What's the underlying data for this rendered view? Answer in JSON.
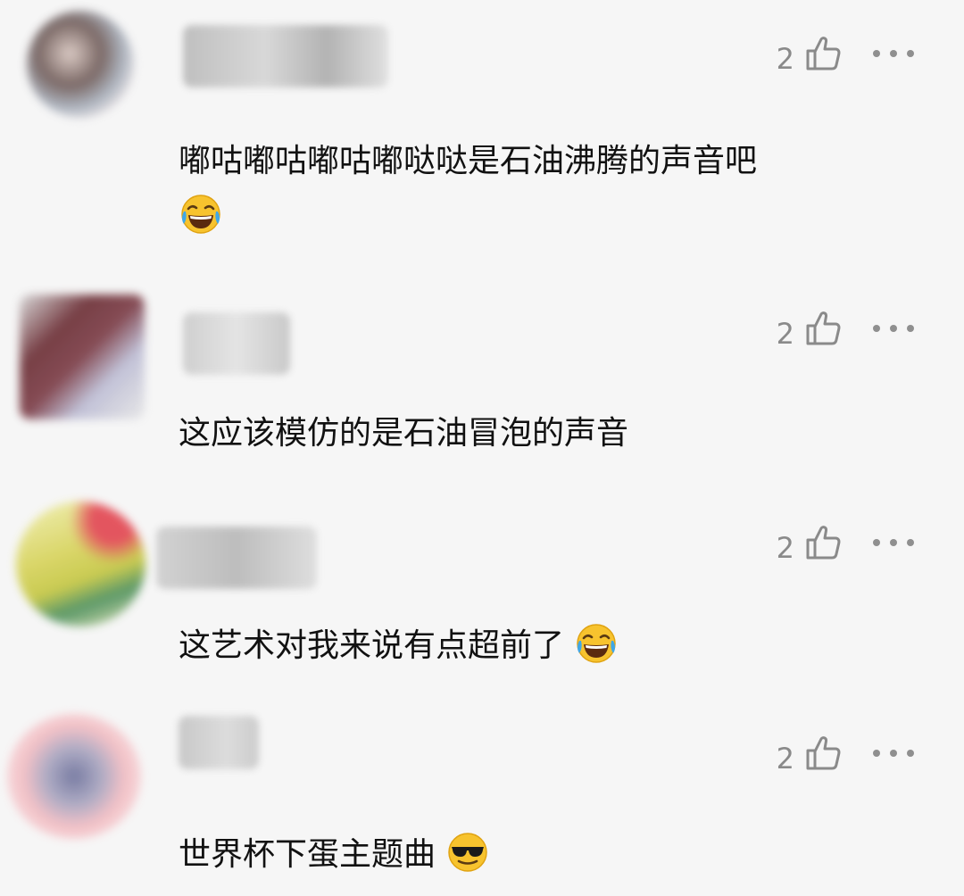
{
  "comments": [
    {
      "like_count": "2",
      "text": "嘟咕嘟咕嘟咕嘟哒哒是石油沸腾的声音吧",
      "emoji": "laughing-tears-emoji"
    },
    {
      "like_count": "2",
      "text": "这应该模仿的是石油冒泡的声音",
      "emoji": ""
    },
    {
      "like_count": "2",
      "text": "这艺术对我来说有点超前了",
      "emoji": "laughing-tears-emoji"
    },
    {
      "like_count": "2",
      "text": "世界杯下蛋主题曲",
      "emoji": "sunglasses-emoji"
    }
  ],
  "icons": {
    "like": "thumbs-up-outline-icon",
    "more": "more-horizontal-icon"
  },
  "colors": {
    "background": "#f6f6f6",
    "text": "#111111",
    "meta": "#8a8a8a"
  }
}
